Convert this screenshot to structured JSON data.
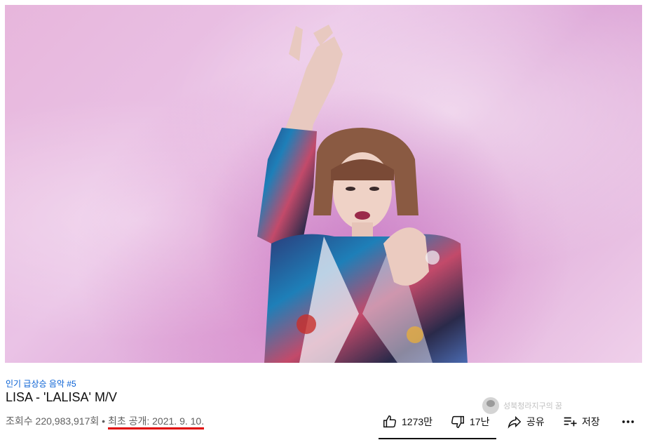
{
  "video": {
    "badge": "인기 급상승 음악 #5",
    "title": "LISA - 'LALISA' M/V",
    "views": "조회수 220,983,917회",
    "separator": "•",
    "date": "최초 공개: 2021. 9. 10."
  },
  "actions": {
    "like_count": "1273만",
    "dislike_count": "17난",
    "share_label": "공유",
    "save_label": "저장",
    "more_icon": "more-horizontal-icon"
  },
  "watermark": {
    "text": "성북청라지구의 꿈"
  },
  "colors": {
    "badge_link": "#065fd4",
    "underline": "#e00000",
    "video_bg": "#e7b6dc"
  }
}
